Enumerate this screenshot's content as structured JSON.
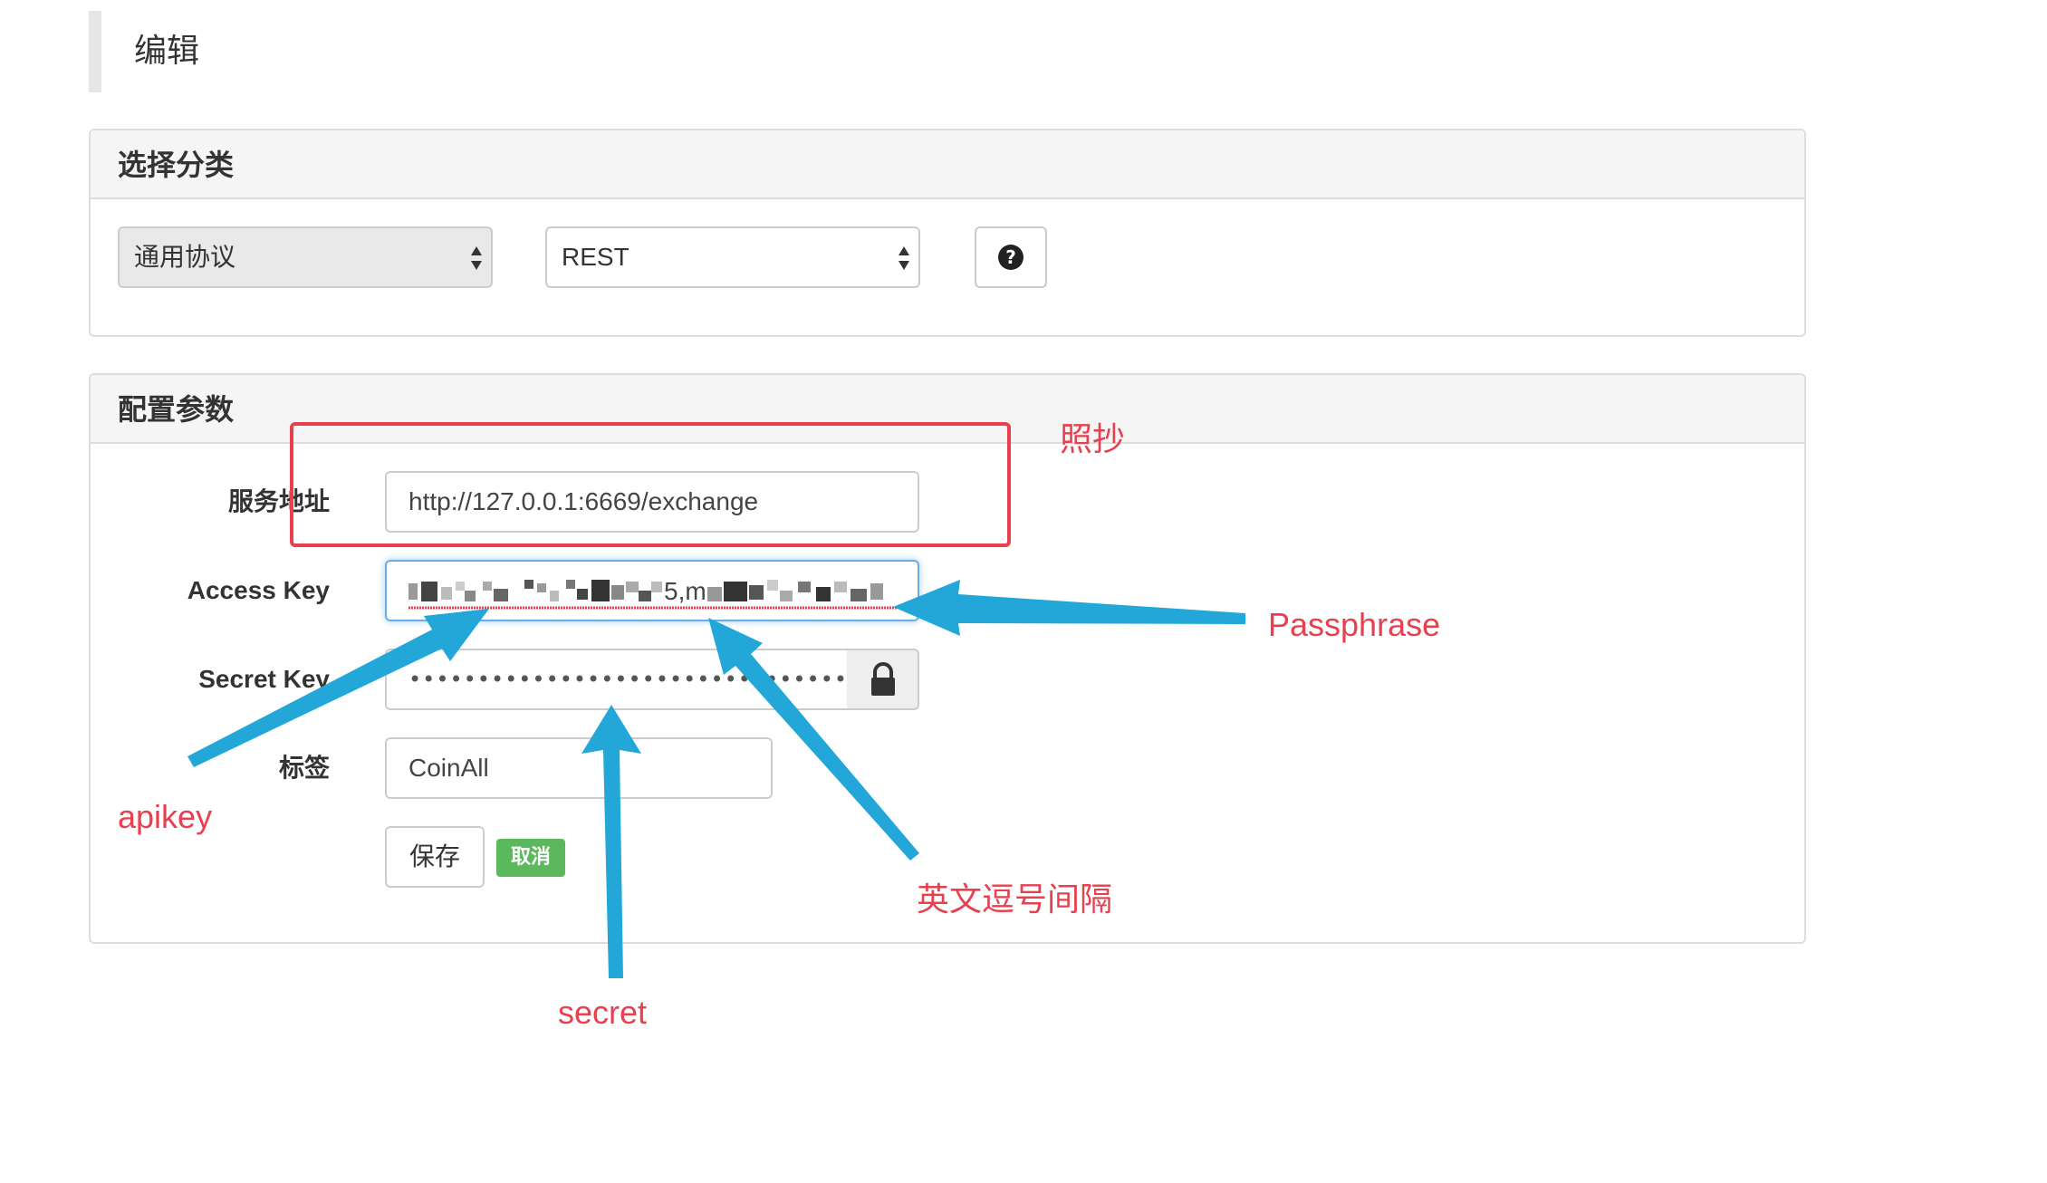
{
  "page": {
    "title": "编辑"
  },
  "category_panel": {
    "heading": "选择分类",
    "protocol_select": {
      "selected": "通用协议"
    },
    "api_type_select": {
      "selected": "REST"
    },
    "help_icon": "question-circle-icon",
    "help_glyph": "?"
  },
  "config_panel": {
    "heading": "配置参数",
    "fields": {
      "service_url": {
        "label": "服务地址",
        "value": "http://127.0.0.1:6669/exchange"
      },
      "access_key": {
        "label": "Access Key",
        "visible_fragment": "5,m"
      },
      "secret_key": {
        "label": "Secret Key",
        "value": "••••••••••••••••••••••••••••••••••••••••••••••••••",
        "lock_icon": "lock-icon"
      },
      "tag": {
        "label": "标签",
        "value": "CoinAll"
      }
    },
    "buttons": {
      "save": "保存",
      "cancel": "取消"
    }
  },
  "annotations": {
    "copy_note": "照抄",
    "passphrase": "Passphrase",
    "apikey": "apikey",
    "comma_note": "英文逗号间隔",
    "secret": "secret",
    "colors": {
      "annotation_red": "#e8404f",
      "arrow_blue": "#22a7d8"
    }
  },
  "colors": {
    "panel_border": "#dddddd",
    "panel_heading_bg": "#f5f5f5",
    "cancel_green": "#5cb85c",
    "focus_blue": "#66afe9"
  }
}
